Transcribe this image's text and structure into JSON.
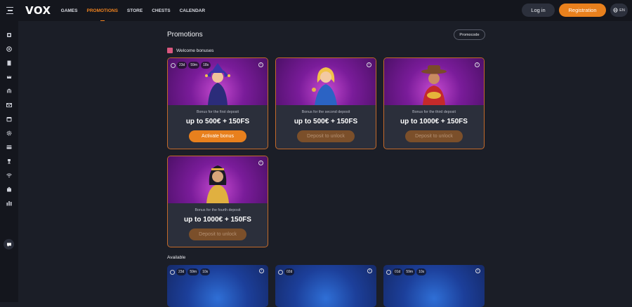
{
  "header": {
    "logo": "VOX",
    "nav": [
      "GAMES",
      "PROMOTIONS",
      "STORE",
      "CHESTS",
      "CALENDAR"
    ],
    "active_nav": "PROMOTIONS",
    "login_label": "Log in",
    "register_label": "Registration",
    "language": "EN",
    "accent_color": "#e8801d"
  },
  "sidebar": {
    "icons": [
      "slots-icon",
      "live-casino-icon",
      "document-icon",
      "crown-icon",
      "bank-icon",
      "mail-icon",
      "calendar-icon",
      "gear-icon",
      "card-icon",
      "trophy-icon",
      "wifi-icon",
      "bag-icon",
      "stats-icon"
    ],
    "chat_icon": "chat-icon"
  },
  "page": {
    "title": "Promotions",
    "promocode_label": "Promocode",
    "welcome_section": "Welcome bonuses",
    "available_section": "Available"
  },
  "welcome_cards": [
    {
      "timer": [
        "23d",
        "59m",
        "18s"
      ],
      "subtitle": "Bonus for the first deposit",
      "amount": "up to 500€ + 150FS",
      "cta": "Activate bonus",
      "cta_state": "active",
      "info": "i"
    },
    {
      "timer": [],
      "subtitle": "Bonus for the second deposit",
      "amount": "up to 500€ + 150FS",
      "cta": "Deposit to unlock",
      "cta_state": "locked",
      "info": "i"
    },
    {
      "timer": [],
      "subtitle": "Bonus for the third deposit",
      "amount": "up to 1000€ + 150FS",
      "cta": "Deposit to unlock",
      "cta_state": "locked",
      "info": "i"
    },
    {
      "timer": [],
      "subtitle": "Bonus for the fourth deposit",
      "amount": "up to 1000€ + 150FS",
      "cta": "Deposit to unlock",
      "cta_state": "locked",
      "info": "i"
    }
  ],
  "available_cards": [
    {
      "timer": [
        "23d",
        "59m",
        "10s"
      ],
      "info": "i"
    },
    {
      "timer": [
        "02d"
      ],
      "info": "i"
    },
    {
      "timer": [
        "01d",
        "59m",
        "10s"
      ],
      "info": "i"
    }
  ]
}
